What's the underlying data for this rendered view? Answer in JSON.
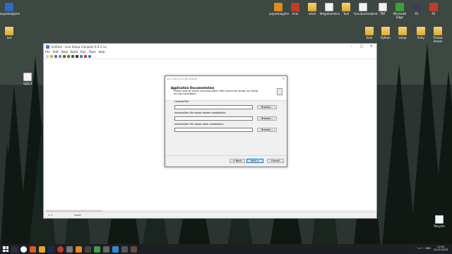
{
  "desktop": {
    "icons_right_top": [
      {
        "label": "auyenkaigiem"
      },
      {
        "label": "hink"
      },
      {
        "label": "ntest"
      },
      {
        "label": "Megahometra"
      },
      {
        "label": "Text"
      },
      {
        "label": "Grautovemakent"
      },
      {
        "label": "TNT"
      },
      {
        "label": "Microsoft Edge"
      },
      {
        "label": "P1"
      },
      {
        "label": "P2"
      },
      {
        "label": "programm"
      }
    ],
    "icons_right_row2": [
      {
        "label": "hink"
      },
      {
        "label": "Python"
      },
      {
        "label": "setup"
      },
      {
        "label": "finity"
      },
      {
        "label": "Timber lesson"
      }
    ],
    "icons_left": [
      {
        "label": "auyenkaigiem"
      },
      {
        "label": "out"
      },
      {
        "label": "ng5p3"
      }
    ],
    "recycle_bin": "Recycle"
  },
  "app": {
    "title": "Untitled - Inno Setup Compiler 6.0.5 (u)",
    "menu": [
      "File",
      "Edit",
      "View",
      "Build",
      "Run",
      "Tools",
      "Help"
    ],
    "status": {
      "position": "1:   1",
      "mode": "Insert"
    }
  },
  "wizard": {
    "title": "Inno Setup Script Wizard",
    "heading": "Application Documentation",
    "subheading": "Please specify which documentation files should be shown by Setup during installation.",
    "fields": [
      {
        "label": "License file:",
        "value": "",
        "browse": "Browse..."
      },
      {
        "label": "Information file shown before installation:",
        "value": "",
        "browse": "Browse..."
      },
      {
        "label": "Information file shown after installation:",
        "value": "",
        "browse": "Browse..."
      }
    ],
    "buttons": {
      "back": "< Back",
      "next": "Next >",
      "cancel": "Cancel"
    }
  },
  "taskbar": {
    "time": "11:50",
    "date": "24.02.2020",
    "lang": "ENG"
  },
  "colors": {
    "accent": "#0078d7",
    "taskbar": "#1c1f24"
  }
}
